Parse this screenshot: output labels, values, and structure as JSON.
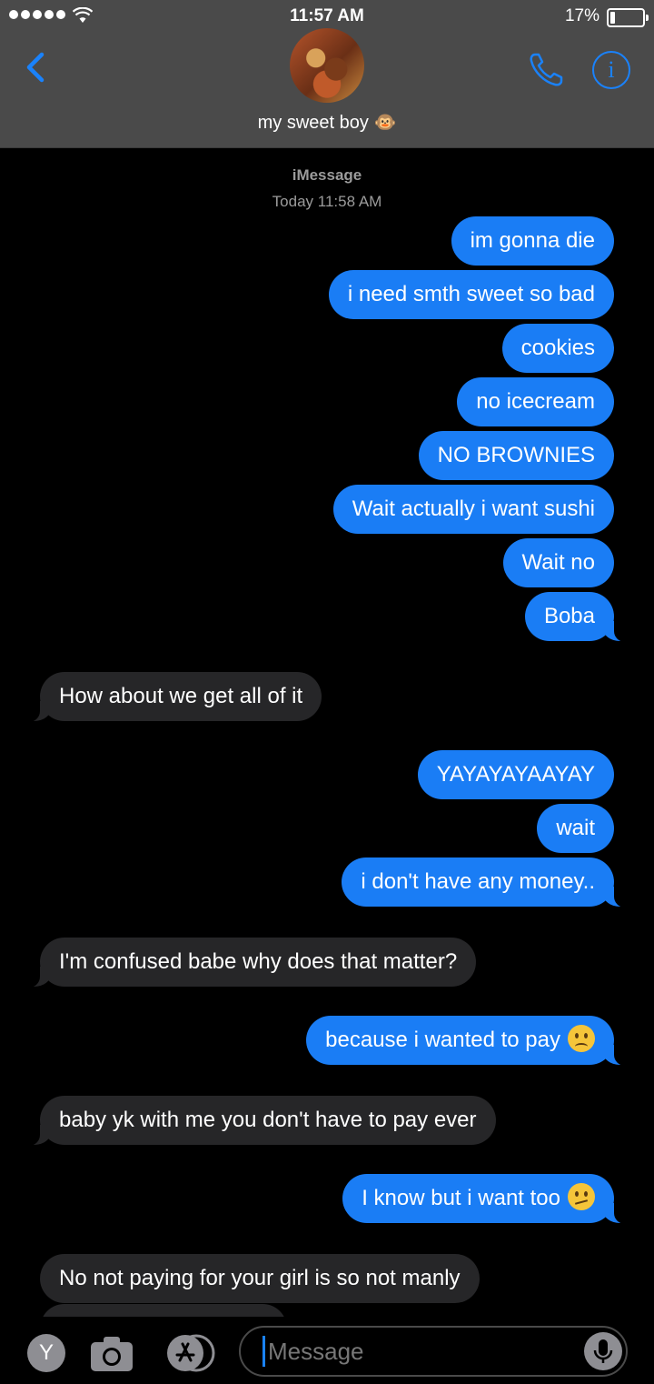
{
  "status": {
    "time": "11:57 AM",
    "battery": "17%"
  },
  "header": {
    "contact_name": "my sweet boy 🐵"
  },
  "thread": {
    "service": "iMessage",
    "timestamp": "Today 11:58 AM"
  },
  "messages": [
    {
      "text": "im gonna die",
      "from": "me"
    },
    {
      "text": "i need smth sweet so bad",
      "from": "me"
    },
    {
      "text": "cookies",
      "from": "me"
    },
    {
      "text": "no icecream",
      "from": "me"
    },
    {
      "text": "NO BROWNIES",
      "from": "me"
    },
    {
      "text": "Wait actually i want sushi",
      "from": "me"
    },
    {
      "text": "Wait no",
      "from": "me"
    },
    {
      "text": "Boba",
      "from": "me"
    },
    {
      "text": "How about we get all of it",
      "from": "them"
    },
    {
      "text": "YAYAYAYAAYAY",
      "from": "me"
    },
    {
      "text": "wait",
      "from": "me"
    },
    {
      "text": "i don't have any money..",
      "from": "me"
    },
    {
      "text": "I'm confused babe why does that matter?",
      "from": "them"
    },
    {
      "text": "because i wanted to pay",
      "from": "me",
      "emoji": "frowning-face"
    },
    {
      "text": "baby yk with me you don't have to pay ever",
      "from": "them"
    },
    {
      "text": "I know but i want too",
      "from": "me",
      "emoji": "confused-face"
    },
    {
      "text": "No not paying for your girl is so not manly",
      "from": "them"
    }
  ],
  "composer": {
    "app_button": "Y",
    "placeholder": "Message"
  },
  "colors": {
    "sent_bubble": "#1a7df5",
    "received_bubble": "#262628",
    "accent": "#1a82fb"
  }
}
